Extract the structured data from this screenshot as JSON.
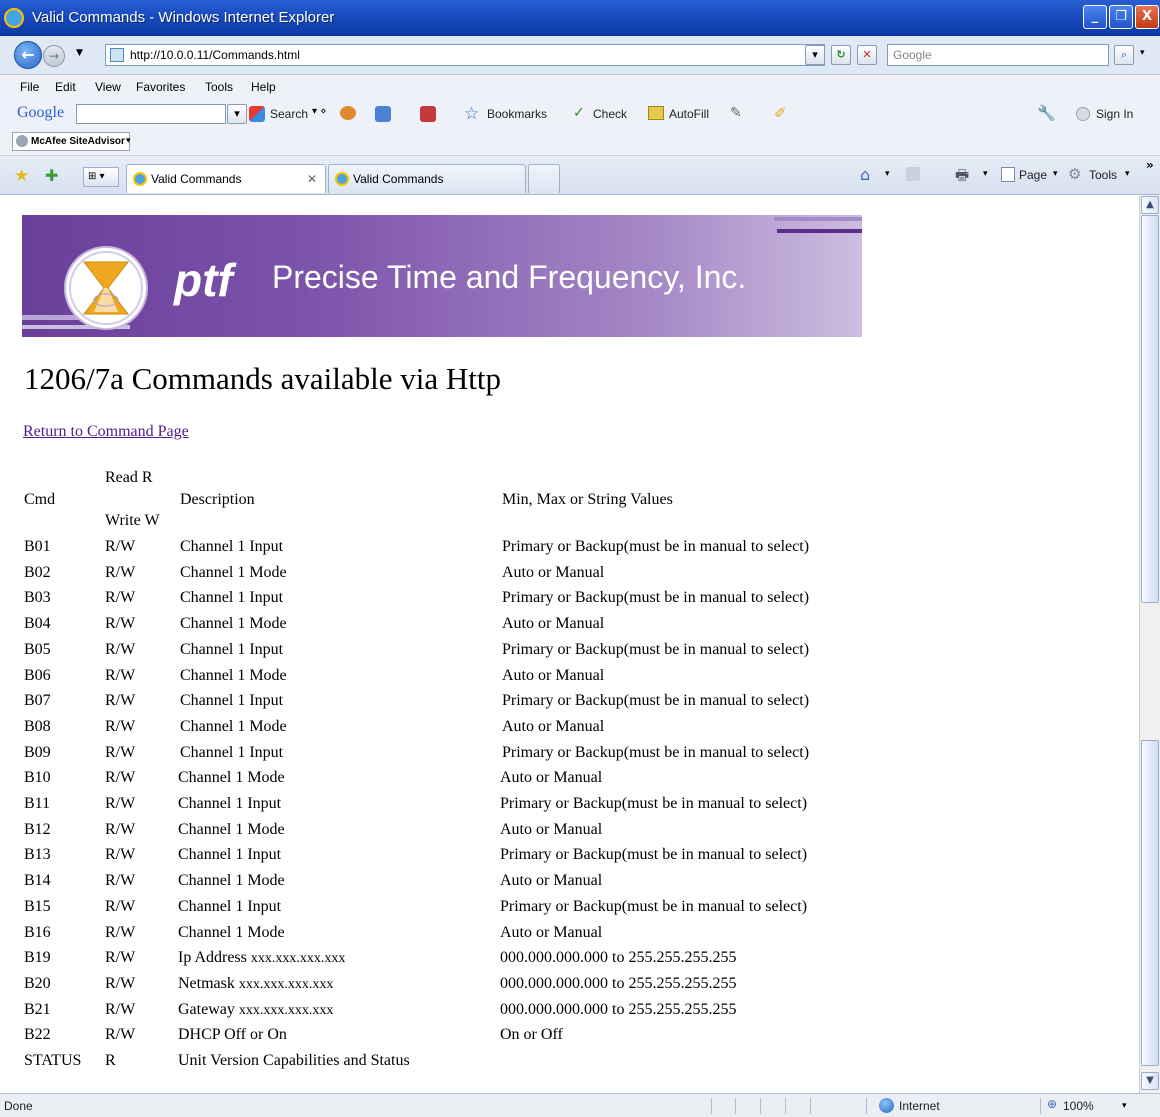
{
  "window": {
    "title": "Valid Commands - Windows Internet Explorer",
    "min_label": "_",
    "max_label": "❐",
    "close_label": "X"
  },
  "address": {
    "url": "http://10.0.0.11/Commands.html",
    "search_placeholder": "Google"
  },
  "menu": {
    "items": [
      "File",
      "Edit",
      "View",
      "Favorites",
      "Tools",
      "Help"
    ]
  },
  "google_toolbar": {
    "logo": "Google",
    "search_label": "Search",
    "bookmarks_label": "Bookmarks",
    "check_label": "Check",
    "autofill_label": "AutoFill",
    "signin_label": "Sign In"
  },
  "mcafee": {
    "label": "McAfee SiteAdvisor"
  },
  "tabs": {
    "items": [
      {
        "label": "Valid Commands",
        "active": true
      },
      {
        "label": "Valid Commands",
        "active": false
      }
    ],
    "page_label": "Page",
    "tools_label": "Tools"
  },
  "banner": {
    "brand": "ptf",
    "company": "Precise Time and Frequency, Inc."
  },
  "page": {
    "title": "1206/7a Commands available via Http",
    "return_link": "Return to Command Page"
  },
  "table": {
    "headers": {
      "cmd": "Cmd",
      "rw_top": "Read R",
      "rw_bottom": "Write W",
      "desc": "Description",
      "values": "Min, Max or String Values"
    },
    "rows": [
      {
        "cmd": "B01",
        "rw": "R/W",
        "desc": "Channel 1 Input",
        "values": "Primary or Backup(must be in manual to select)"
      },
      {
        "cmd": "B02",
        "rw": "R/W",
        "desc": "Channel 1 Mode",
        "values": "Auto or Manual"
      },
      {
        "cmd": "B03",
        "rw": "R/W",
        "desc": "Channel 1 Input",
        "values": "Primary or Backup(must be in manual to select)"
      },
      {
        "cmd": "B04",
        "rw": "R/W",
        "desc": "Channel 1 Mode",
        "values": "Auto or Manual"
      },
      {
        "cmd": "B05",
        "rw": "R/W",
        "desc": "Channel 1 Input",
        "values": "Primary or Backup(must be in manual to select)"
      },
      {
        "cmd": "B06",
        "rw": "R/W",
        "desc": "Channel 1 Mode",
        "values": "Auto or Manual"
      },
      {
        "cmd": "B07",
        "rw": "R/W",
        "desc": "Channel 1 Input",
        "values": "Primary or Backup(must be in manual to select)"
      },
      {
        "cmd": "B08",
        "rw": "R/W",
        "desc": "Channel 1 Mode",
        "values": "Auto or Manual"
      },
      {
        "cmd": "B09",
        "rw": "R/W",
        "desc": "Channel 1 Input",
        "values": "Primary or Backup(must be in manual to select)"
      },
      {
        "cmd": "B10",
        "rw": "R/W",
        "desc": "Channel 1 Mode",
        "values": "Auto or Manual"
      },
      {
        "cmd": "B11",
        "rw": "R/W",
        "desc": "Channel 1 Input",
        "values": "Primary or Backup(must be in manual to select)"
      },
      {
        "cmd": "B12",
        "rw": "R/W",
        "desc": "Channel 1 Mode",
        "values": "Auto or Manual"
      },
      {
        "cmd": "B13",
        "rw": "R/W",
        "desc": "Channel 1 Input",
        "values": "Primary or Backup(must be in manual to select)"
      },
      {
        "cmd": "B14",
        "rw": "R/W",
        "desc": "Channel 1 Mode",
        "values": "Auto or Manual"
      },
      {
        "cmd": "B15",
        "rw": "R/W",
        "desc": "Channel 1 Input",
        "values": "Primary or Backup(must be in manual to select)"
      },
      {
        "cmd": "B16",
        "rw": "R/W",
        "desc": "Channel 1 Mode",
        "values": "Auto or Manual"
      },
      {
        "cmd": "B19",
        "rw": "R/W",
        "desc": "Ip Address",
        "desc_small": "xxx.xxx.xxx.xxx",
        "values": "000.000.000.000 to 255.255.255.255"
      },
      {
        "cmd": "B20",
        "rw": "R/W",
        "desc": "Netmask",
        "desc_small": "xxx.xxx.xxx.xxx",
        "values": "000.000.000.000 to 255.255.255.255"
      },
      {
        "cmd": "B21",
        "rw": "R/W",
        "desc": "Gateway",
        "desc_small": "xxx.xxx.xxx.xxx",
        "values": "000.000.000.000 to 255.255.255.255"
      },
      {
        "cmd": "B22",
        "rw": "R/W",
        "desc": "DHCP Off or On",
        "values": "On or Off"
      },
      {
        "cmd": "STATUS",
        "rw": "R",
        "desc": "Unit Version Capabilities and Status",
        "values": ""
      }
    ]
  },
  "status": {
    "text": "Done",
    "zone": "Internet",
    "zoom": "100%"
  }
}
